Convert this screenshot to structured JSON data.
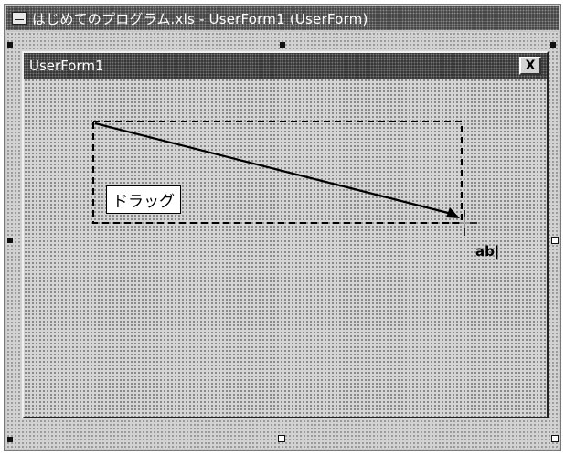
{
  "window": {
    "title": "はじめてのプログラム.xls - UserForm1 (UserForm)"
  },
  "userform": {
    "caption": "UserForm1",
    "close_symbol": "X"
  },
  "annotation": {
    "drag_label": "ドラッグ"
  },
  "cursor": {
    "tool_hint": "ab|"
  },
  "colors": {
    "titlebar": "#3a3a3a",
    "form_background": "#d4d4d4"
  }
}
